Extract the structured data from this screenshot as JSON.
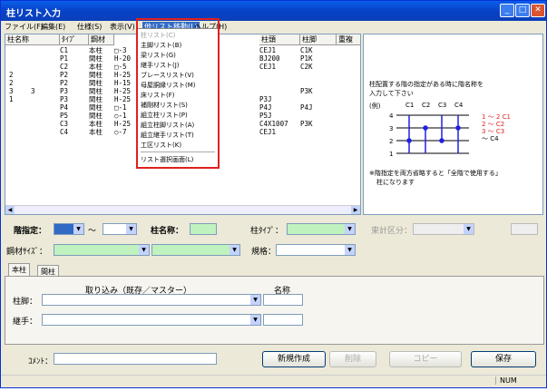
{
  "window": {
    "title": "柱リスト入力"
  },
  "menu": [
    "ファイル(F)",
    "編集(E)",
    "仕様(S)",
    "表示(V)",
    "他リスト移動(L)",
    "ヘルプ(H)"
  ],
  "dropdown_items": [
    "柱リスト(C)",
    "主脚リスト(B)",
    "梁リスト(G)",
    "継手リスト(J)",
    "ブレースリスト(V)",
    "母屋胴縁リスト(M)",
    "床リスト(F)",
    "補剛材リスト(S)",
    "組立柱リスト(P)",
    "組立柱脚リスト(A)",
    "組立継手リスト(T)",
    "工区リスト(K)",
    "リスト選択画面(L)"
  ],
  "grid": {
    "headers": [
      "柱名称",
      "ﾀｲﾌﾟ",
      "鋼材",
      "柱頭",
      "柱脚",
      "重複"
    ],
    "rows": [
      [
        "",
        "",
        "C1",
        "本柱",
        "□-3",
        "CEJ1",
        "C1K"
      ],
      [
        "",
        "",
        "P1",
        "間柱",
        "H-20",
        "BJ200",
        "P1K"
      ],
      [
        "",
        "",
        "C2",
        "本柱",
        "□-5",
        "CEJ1",
        "C2K"
      ],
      [
        "2",
        "",
        "P2",
        "間柱",
        "H-25",
        "",
        ""
      ],
      [
        "2",
        "",
        "P2",
        "間柱",
        "H-15",
        "",
        ""
      ],
      [
        "3",
        "3",
        "P3",
        "間柱",
        "H-25",
        "",
        "P3K"
      ],
      [
        "1",
        "",
        "P3",
        "間柱",
        "H-25",
        "P3J",
        ""
      ],
      [
        "",
        "",
        "P4",
        "間柱",
        "□-1",
        "P4J",
        "P4J"
      ],
      [
        "",
        "",
        "P5",
        "間柱",
        "○-1",
        "P5J",
        ""
      ],
      [
        "",
        "",
        "C3",
        "本柱",
        "H-25",
        "C4X1007",
        "P3K"
      ],
      [
        "",
        "",
        "C4",
        "本柱",
        "○-7",
        "CEJ1",
        ""
      ]
    ]
  },
  "diagram": {
    "note1": "柱配置する階の指定がある時に階名称を",
    "note2": "入力して下さい",
    "example": "(例)",
    "cols": [
      "C1",
      "C2",
      "C3",
      "C4"
    ],
    "floors": [
      "4",
      "3",
      "2",
      "1"
    ],
    "legend": [
      "1 ～ 2  C1",
      "2 ～    C2",
      "3 ～    C3",
      "  ～    C4"
    ],
    "note3": "※階指定を両方省略すると「全階で使用する」",
    "note4": "柱になります"
  },
  "form": {
    "floor_label": "階指定：",
    "tilde": "～",
    "name_label": "柱名称：",
    "type_label": "柱ﾀｲﾌﾟ：",
    "kouji_label": "東計区分：",
    "steel_label": "鋼材ｻｲｽﾞ：",
    "spec_label": "規格：",
    "tabs": [
      "本柱",
      "間柱"
    ],
    "import_label": "取り込み（既存／マスター）",
    "name_col": "名称",
    "base_label": "柱脚：",
    "joint_label": "継手：",
    "comment_label": "ｺﾒﾝﾄ："
  },
  "buttons": {
    "new": "新規作成",
    "delete": "削除",
    "copy": "コピー",
    "save": "保存"
  },
  "status": {
    "num": "NUM"
  }
}
